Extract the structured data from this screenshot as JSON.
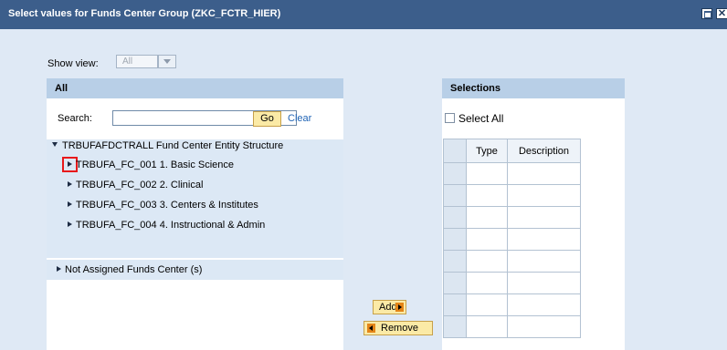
{
  "dialog": {
    "title": "Select values for Funds Center Group (ZKC_FCTR_HIER)",
    "max_button": "□",
    "close_button": "✕"
  },
  "show_view": {
    "label": "Show view:",
    "value": "All"
  },
  "left_panel": {
    "header": "All",
    "search_label": "Search:",
    "search_value": "",
    "go_label": "Go",
    "clear_label": "Clear",
    "tree": {
      "root": "TRBUFAFDCTRALL Fund Center Entity Structure",
      "children": [
        "TRBUFA_FC_001 1.  Basic Science",
        "TRBUFA_FC_002 2.  Clinical",
        "TRBUFA_FC_003 3.  Centers & Institutes",
        "TRBUFA_FC_004 4.  Instructional & Admin"
      ],
      "not_assigned": "Not Assigned Funds Center (s)"
    }
  },
  "buttons": {
    "add": "Add",
    "remove": "Remove"
  },
  "right_panel": {
    "header": "Selections",
    "select_all": "Select All",
    "columns": [
      "Type",
      "Description"
    ],
    "row_count": 8
  },
  "colors": {
    "titlebar": "#3c5e8b",
    "background": "#dfe9f5",
    "panel_header": "#b8cfe7",
    "tree_bg": "#dce8f5",
    "button_bg": "#fbeaa6",
    "button_arrow": "#e48518",
    "link": "#1f63b5",
    "highlight": "#e8191b"
  }
}
